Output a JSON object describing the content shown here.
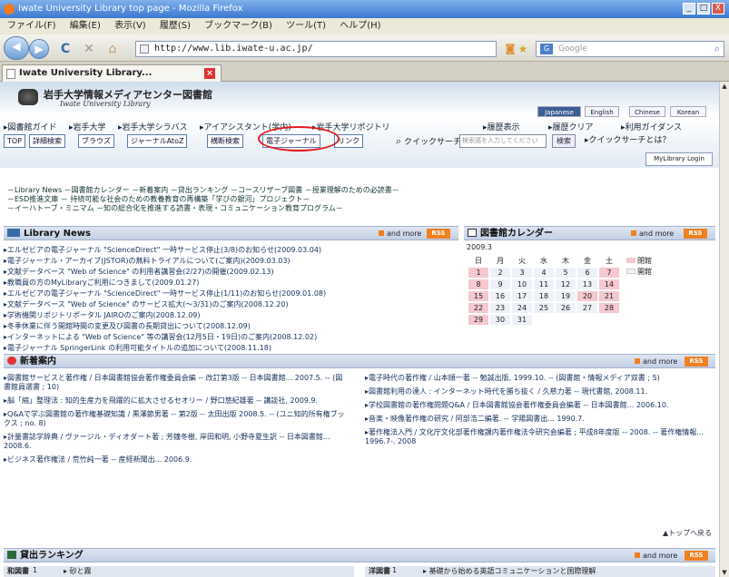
{
  "window": {
    "title": "Iwate University Library top page - Mozilla Firefox",
    "controls": [
      "_",
      "□",
      "X"
    ]
  },
  "menu": [
    "ファイル(F)",
    "編集(E)",
    "表示(V)",
    "履歴(S)",
    "ブックマーク(B)",
    "ツール(T)",
    "ヘルプ(H)"
  ],
  "nav": {
    "back": "◀",
    "forward": "▶",
    "reload": "C",
    "stop": "✕",
    "home": "⌂",
    "url": "http://www.lib.iwate-u.ac.jp/",
    "search_placeholder": "Google"
  },
  "tab": {
    "title": "Iwate University Library..."
  },
  "header": {
    "library_name": "岩手大学情報メディアセンター図書館",
    "library_sub": "Iwate University Library",
    "languages": [
      "Japanese",
      "English",
      "Chinese",
      "Korean"
    ]
  },
  "links_left": [
    "図書館ガイド",
    "岩手大学",
    "岩手大学シラバス",
    "アイアシスタント(学内)",
    "岩手大学リポジトリ"
  ],
  "links_right": [
    "履歴表示",
    "履歴クリア",
    "利用ガイダンス"
  ],
  "nav2": {
    "buttons": [
      "TOP",
      "詳細検索",
      "ブラウズ",
      "ジャーナルAtoZ",
      "横断検索",
      "電子ジャーナル",
      "リンク"
    ],
    "quick_search_label": "クイックサーチ",
    "quick_search_placeholder": "検索語を入力してください",
    "search_button": "検索",
    "about": "クイックサーチとは？",
    "mylibrary": "MyLibrary Login"
  },
  "notices": [
    "－Library News －図書館カレンダー －新着案内 －貸出ランキング －コースリザーブ図書 －授業理解のための必読書－",
    "－ESD推進文庫 － 持続可能な社会のための教養教育の再構築「学びの銀河」プロジェクト－",
    "－イーハトーブ・ミニマム －知の総合化を推進する読書・表現・コミュニケーション教育プログラム－"
  ],
  "news": {
    "title": "Library News",
    "and_more": "and more",
    "rss": "RSS",
    "items": [
      "エルゼビアの電子ジャーナル \"ScienceDirect\" 一時サービス停止(3/8)のお知らせ(2009.03.04)",
      "電子ジャーナル・アーカイブ(JSTOR)の無料トライアルについて(ご案内)(2009.03.03)",
      "文献データベース \"Web of Science\" の利用者講習会(2/27)の開催(2009.02.13)",
      "教職員の方のMyLibraryご利用につきまして(2009.01.27)",
      "エルゼビアの電子ジャーナル \"ScienceDirect\" 一時サービス停止(1/11)のお知らせ(2009.01.08)",
      "文献データベース \"Web of Science\" のサービス拡大(〜3/31)のご案内(2008.12.20)",
      "学術機関リポジトリポータル JAIROのご案内(2008.12.09)",
      "冬季休業に伴う開館時間の変更及び図書の長期貸出について(2008.12.09)",
      "インターネットによる \"Web of Science\" 等の講習会(12月5日・19日)のご案内(2008.12.02)",
      "電子ジャーナル SpringerLink の利用可能タイトルの追加について(2008.11.18)"
    ]
  },
  "calendar": {
    "title": "図書館カレンダー",
    "and_more": "and more",
    "rss": "RSS",
    "month": "2009.3",
    "weekdays": [
      "日",
      "月",
      "火",
      "水",
      "木",
      "金",
      "土"
    ],
    "weeks": [
      [
        "1",
        "2",
        "3",
        "4",
        "5",
        "6",
        "7"
      ],
      [
        "8",
        "9",
        "10",
        "11",
        "12",
        "13",
        "14"
      ],
      [
        "15",
        "16",
        "17",
        "18",
        "19",
        "20",
        "21"
      ],
      [
        "22",
        "23",
        "24",
        "25",
        "26",
        "27",
        "28"
      ],
      [
        "29",
        "30",
        "31",
        "",
        "",
        "",
        ""
      ]
    ],
    "legend": [
      "閉館",
      "開館"
    ],
    "colors": {
      "closed": "#f6c8d0",
      "open": "#eef2f8"
    }
  },
  "acquisitions": {
    "title": "新着案内",
    "and_more": "and more",
    "rss": "RSS",
    "left": [
      "図書館サービスと著作権 / 日本図書館協会著作権委員会編 -- 改訂第3版 -- 日本図書館... 2007.5. -- (図書館員選書 ; 10)",
      "脳「縮」整理法 : 知的生産力を飛躍的に拡大させるセオリー / 野口悠紀雄著 -- 講談社, 2009.9.",
      "Q&Aで学ぶ図書館の著作権基礎知識 / 黒澤節男著 -- 第2版 -- 太田出版 2008.5. -- (ユニ知的所有権ブックス ; no. 8)",
      "計量書誌学辞典 / ヴァージル・ディオダート著 ; 芳鐘冬樹, 岸田和明, 小野寺夏生訳 -- 日本図書館... 2008.6.",
      "ビジネス著作権法 / 荒竹純一著 -- 産経新聞出... 2006.9."
    ],
    "right": [
      "電子時代の著作権 / 山本順一著 -- 勉誠出版, 1999.10. -- (図書館・情報メディア双書 ; 5)",
      "図書館利用の達人 : インターネット時代を勝ち抜く / 久慈力著 -- 現代書館, 2008.11.",
      "学校図書館の著作権問題Q&A / 日本図書館協会著作権委員会編著 -- 日本図書館... 2006.10.",
      "音楽・映像著作権の研究 / 阿部浩二編著. -- 学陽図書出... 1990.7.",
      "著作権法入門 / 文化庁文化部著作権課内著作権法令研究会編著 ; 平成8年度版 -- 2008. -- 著作権情報... 1996.7-. 2008"
    ],
    "to_top": "▲トップへ戻る"
  },
  "ranking": {
    "title": "貸出ランキング",
    "and_more": "and more",
    "rss": "RSS",
    "japanese_head": "和図書",
    "western_head": "洋図書",
    "jp_rank": "1",
    "jp_title": "砂と霧",
    "west_rank": "1",
    "west_title": "基礎から始める英語コミュニケーションと国際理解"
  }
}
